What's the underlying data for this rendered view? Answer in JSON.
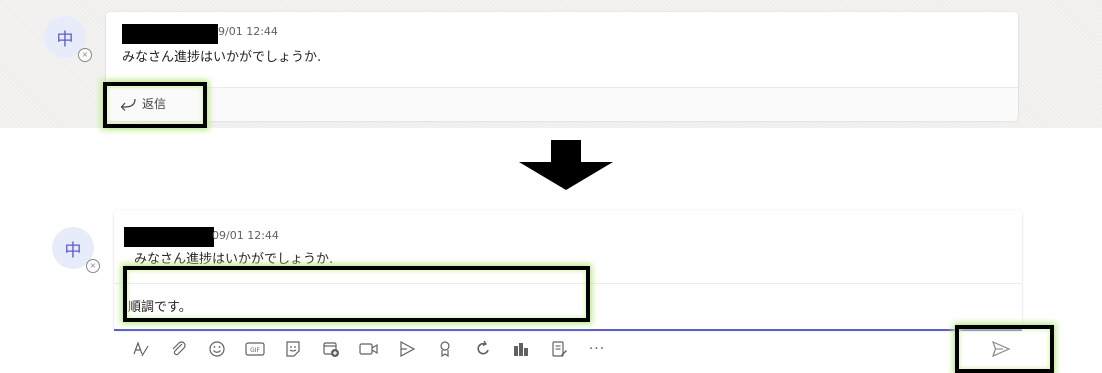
{
  "top": {
    "avatar_initial": "中",
    "author_visible": "",
    "timestamp": "9/01 12:44",
    "message": "みなさん進捗はいかがでしょうか.",
    "reply_label": "返信"
  },
  "bottom": {
    "avatar_initial": "中",
    "timestamp": "09/01 12:44",
    "message": "みなさん進捗はいかがでしょうか.",
    "compose_text": "順調です。",
    "more_label": "···"
  },
  "toolbar": [
    {
      "name": "format-icon"
    },
    {
      "name": "attach-icon"
    },
    {
      "name": "emoji-icon"
    },
    {
      "name": "gif-icon",
      "text": "GIF"
    },
    {
      "name": "sticker-icon"
    },
    {
      "name": "meet-now-icon"
    },
    {
      "name": "video-icon"
    },
    {
      "name": "stream-icon"
    },
    {
      "name": "praise-icon"
    },
    {
      "name": "loop-icon"
    },
    {
      "name": "apps-icon"
    },
    {
      "name": "forms-icon"
    },
    {
      "name": "more-options-icon"
    }
  ],
  "colors": {
    "accent": "#5b5fc7",
    "highlight_glow": "#b8e986",
    "panel_bg": "#f3f2f1",
    "avatar_bg": "#e8ebfa"
  }
}
